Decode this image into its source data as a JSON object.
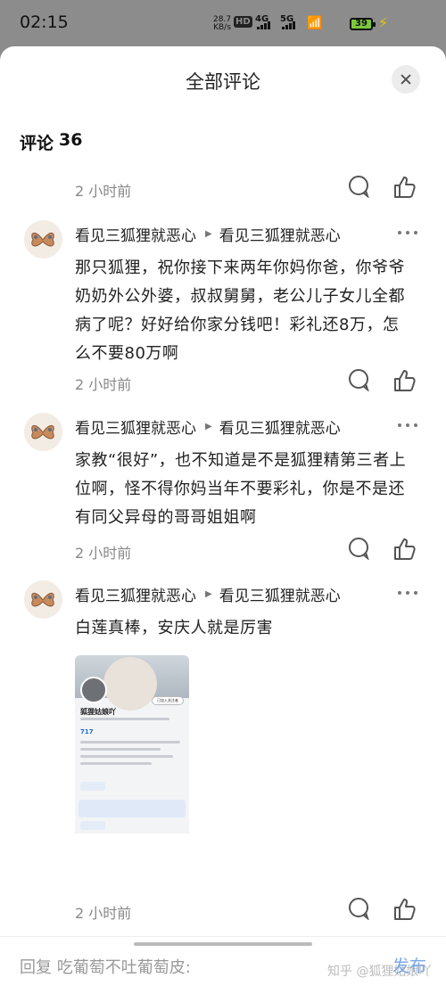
{
  "status_bar": {
    "time": "02:15",
    "net_speed": "28.7",
    "net_unit": "KB/s",
    "hd": "HD",
    "sig1_label": "4G",
    "sig2_label": "5G",
    "battery": "39"
  },
  "sheet": {
    "title": "全部评论",
    "count_label": "评论",
    "count_value": "36"
  },
  "top_meta": {
    "time": "2 小时前"
  },
  "comments": [
    {
      "author": "看见三狐狸就恶心",
      "reply_to": "看见三狐狸就恶心",
      "text": "那只狐狸，祝你接下来两年你妈你爸，你爷爷奶奶外公外婆，叔叔舅舅，老公儿子女儿全都病了呢？好好给你家分钱吧！彩礼还8万，怎么不要80万啊",
      "time": "2 小时前"
    },
    {
      "author": "看见三狐狸就恶心",
      "reply_to": "看见三狐狸就恶心",
      "text": "家教“很好”，也不知道是不是狐狸精第三者上位啊，怪不得你妈当年不要彩礼，你是不是还有同父异母的哥哥姐姐啊",
      "time": "2 小时前"
    },
    {
      "author": "看见三狐狸就恶心",
      "reply_to": "看见三狐狸就恶心",
      "text": "白莲真棒，安庆人就是厉害",
      "time": "2 小时前",
      "attachment": {
        "name": "狐狸姑娘吖",
        "follow": "已加入关注者",
        "stat": "717"
      }
    }
  ],
  "reply_bar": {
    "placeholder": "回复 吃葡萄不吐葡萄皮:",
    "publish": "发布",
    "watermark": "知乎 @狐狸姑娘吖"
  },
  "icons": {
    "reply": "comment-bubble-icon",
    "like": "thumbs-up-icon",
    "more": "more-dots-icon",
    "close": "close-icon"
  }
}
